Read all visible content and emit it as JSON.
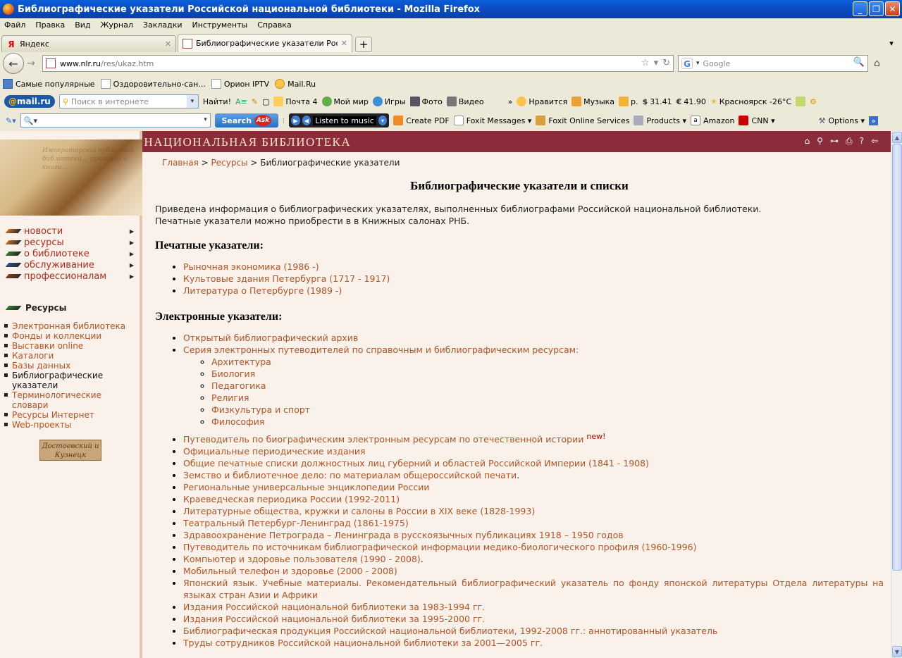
{
  "window": {
    "title": "Библиографические указатели Российской национальной библиотеки - Mozilla Firefox",
    "min": "_",
    "max": "❐",
    "close": "✕"
  },
  "menu": [
    "Файл",
    "Правка",
    "Вид",
    "Журнал",
    "Закладки",
    "Инструменты",
    "Справка"
  ],
  "tabs": [
    {
      "label": "Яндекс",
      "active": false
    },
    {
      "label": "Библиографические указатели Россий...",
      "active": true
    }
  ],
  "nav": {
    "url_domain": "www.nlr.ru",
    "url_path": "/res/ukaz.htm",
    "search_placeholder": "Google"
  },
  "bookmarks": [
    "Самые популярные",
    "Оздоровительно-сан...",
    "Орион IPTV",
    "Mail.Ru"
  ],
  "mailru": {
    "logo_at": "@",
    "logo_text": "mail.ru",
    "search_placeholder": "Поиск в интернете",
    "find": "Найти!",
    "items": [
      "Почта 4",
      "Мой мир",
      "Игры",
      "Фото",
      "Видео",
      "»",
      "Нравится",
      "Музыка",
      "р.",
      "31.41",
      "41.90",
      "Красноярск -26°C"
    ]
  },
  "ask": {
    "search_label": "Search",
    "ask_logo": "Ask",
    "music_label": "Listen to music",
    "items": [
      "Create PDF",
      "Foxit Messages ▾",
      "Foxit Online Services",
      "Products ▾",
      "Amazon",
      "CNN ▾",
      "Options ▾"
    ]
  },
  "site": {
    "title": "РОССИЙСКАЯ НАЦИОНАЛЬНАЯ БИБЛИОТЕКА",
    "hero_script": "Императорскій публичной библіотеки… рукописи и книги…",
    "main_nav": [
      {
        "label": "новости",
        "color": "#c86a1c"
      },
      {
        "label": "ресурсы",
        "color": "#c86a1c"
      },
      {
        "label": "о библиотеке",
        "color": "#2d7a2d"
      },
      {
        "label": "обслуживание",
        "color": "#2d4f8b"
      },
      {
        "label": "профессионалам",
        "color": "#8b3a1c"
      }
    ],
    "section_title": "Ресурсы",
    "sub_nav": [
      {
        "label": "Электронная библиотека",
        "current": false
      },
      {
        "label": "Фонды и коллекции",
        "current": false
      },
      {
        "label": "Выставки online",
        "current": false
      },
      {
        "label": "Каталоги",
        "current": false
      },
      {
        "label": "Базы данных",
        "current": false
      },
      {
        "label": "Библиографические указатели",
        "current": true
      },
      {
        "label": "Терминологические словари",
        "current": false
      },
      {
        "label": "Ресурсы Интернет",
        "current": false
      },
      {
        "label": "Web-проекты",
        "current": false
      }
    ],
    "badge": "Достоевский и Кузнецк"
  },
  "breadcrumb": {
    "home": "Главная",
    "sep": " > ",
    "resources": "Ресурсы",
    "current": "Библиографические указатели"
  },
  "page": {
    "title": "Библиографические указатели и списки",
    "intro1": "Приведена информация о библиографических указателях, выполненных библиографами Российской национальной библиотеки.",
    "intro2": "Печатные указатели можно приобрести в в Книжных салонах РНБ.",
    "printed_heading": "Печатные указатели:",
    "printed": [
      "Рыночная экономика (1986 -)",
      "Культовые здания Петербурга (1717 - 1917)",
      "Литература о Петербурге (1989 -)"
    ],
    "electronic_heading": "Электронные указатели:",
    "electronic_top": [
      "Открытый библиографический архив",
      "Серия электронных путеводителей по справочным и библиографическим ресурсам:"
    ],
    "series": [
      "Архитектура",
      "Биология",
      "Педагогика",
      "Религия",
      "Физкультура и спорт",
      "Философия"
    ],
    "new_badge": "new!",
    "electronic_rest": [
      "Путеводитель по биографическим электронным ресурсам по отечественной истории",
      "Официальные периодические издания",
      "Общие печатные списки должностных лиц губерний и областей Российской Империи (1841 - 1908)",
      "Земство и библиотечное дело: по материалам общероссийской печати",
      "Региональные универсальные энциклопедии России",
      "Краеведческая периодика России (1992-2011)",
      "Литературные общества, кружки и салоны в России в XIX веке (1828-1993)",
      "Театральный Петербург-Ленинград (1861-1975)",
      "Здравоохранение Петрограда – Ленинграда в русскоязычных публикациях 1918 – 1950 годов",
      "Путеводитель по источникам библиографической информации медико-биологического профиля (1960-1996)",
      "Компьютер и здоровье пользователя (1990 - 2008)",
      "Мобильный телефон и здоровье (2000 - 2008)",
      "Японский язык. Учебные материалы. Рекомендательный библиографический указатель по фонду японской литературы Отдела литературы на языках стран Азии и Африки",
      "Издания Российской национальной библиотеки за 1983-1994 гг.",
      "Издания Российской национальной библиотеки за 1995-2000 гг.",
      "Библиографическая продукция Российской национальной библиотеки, 1992-2008 гг.: аннотированный указатель",
      "Труды сотрудников Российской национальной библиотеки за 2001—2005 гг."
    ]
  }
}
